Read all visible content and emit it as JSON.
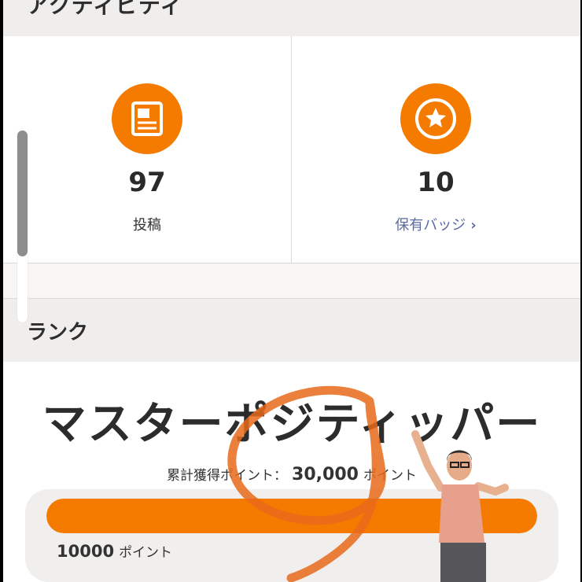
{
  "activity": {
    "title": "アクティビティ",
    "posts": {
      "value": "97",
      "label": "投稿",
      "icon": "document-icon"
    },
    "badges": {
      "value": "10",
      "label": "保有バッジ",
      "icon": "star-badge-icon"
    }
  },
  "rank": {
    "title": "ランク",
    "name": "マスターポジティッパー",
    "total_label": "累計獲得ポイント：",
    "total_value": "30,000",
    "total_unit": "ポイント",
    "goal_value": "10000",
    "goal_unit": "ポイント",
    "progress_fraction": 1.0
  },
  "colors": {
    "accent": "#f47a00",
    "link": "#5a6aa5"
  }
}
